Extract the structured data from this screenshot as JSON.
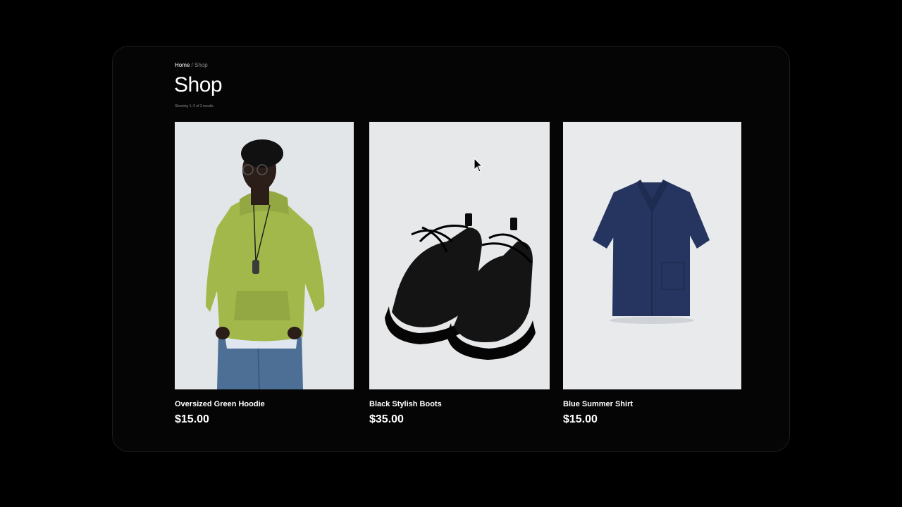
{
  "breadcrumb": {
    "home": "Home",
    "separator": "/",
    "current": "Shop"
  },
  "page": {
    "title": "Shop",
    "results": "Showing 1–3 of 3 results"
  },
  "products": [
    {
      "name": "Oversized Green Hoodie",
      "price": "$15.00"
    },
    {
      "name": "Black Stylish Boots",
      "price": "$35.00"
    },
    {
      "name": "Blue Summer Shirt",
      "price": "$15.00"
    }
  ],
  "colors": {
    "background": "#000000",
    "frame": "#050505",
    "image_bg": "#e6e8ea",
    "hoodie": "#a3b84a",
    "shirt": "#25355f",
    "boots": "#111111"
  }
}
